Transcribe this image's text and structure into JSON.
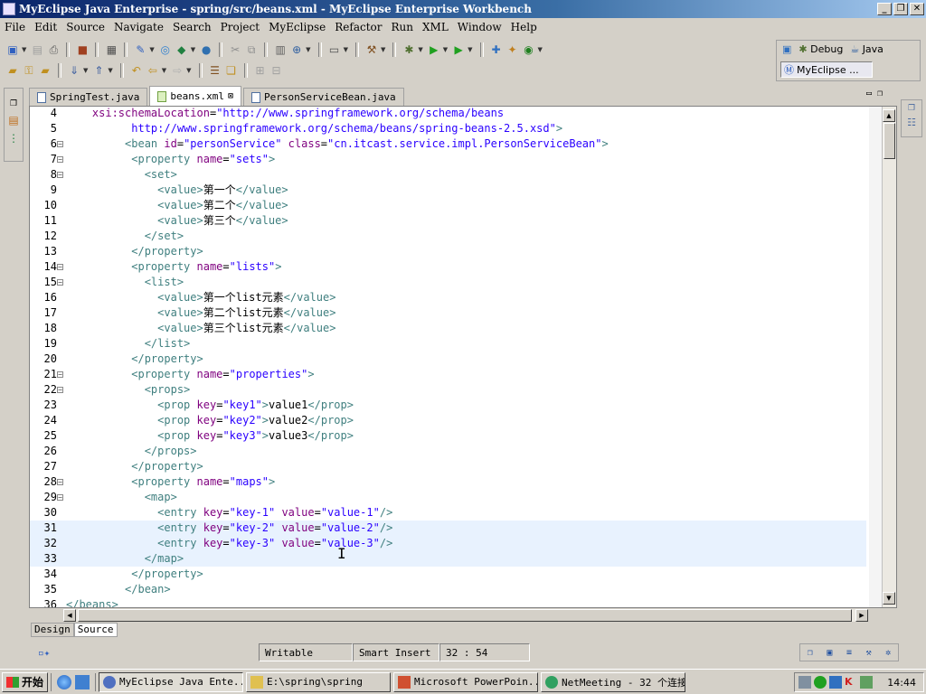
{
  "window": {
    "title": "MyEclipse Java Enterprise - spring/src/beans.xml - MyEclipse Enterprise Workbench",
    "controls": [
      "_",
      "❐",
      "✕"
    ]
  },
  "menu": [
    "File",
    "Edit",
    "Source",
    "Navigate",
    "Search",
    "Project",
    "MyEclipse",
    "Refactor",
    "Run",
    "XML",
    "Window",
    "Help"
  ],
  "perspectives": {
    "debug": "Debug",
    "java": "Java",
    "myeclipse": "MyEclipse ..."
  },
  "tabs": [
    {
      "label": "SpringTest.java",
      "active": false
    },
    {
      "label": "beans.xml",
      "active": true
    },
    {
      "label": "PersonServiceBean.java",
      "active": false
    }
  ],
  "code_lines": [
    {
      "n": "4",
      "indent": "    ",
      "parts": [
        [
          "a",
          "xsi:schemaLocation"
        ],
        [
          "x",
          "="
        ],
        [
          "v",
          "\"http://www.springframework.org/schema/beans"
        ]
      ]
    },
    {
      "n": "5",
      "indent": "          ",
      "parts": [
        [
          "v",
          "http://www.springframework.org/schema/beans/spring-beans-2.5.xsd\""
        ],
        [
          "t",
          ">"
        ]
      ]
    },
    {
      "n": "6",
      "fold": true,
      "indent": "         ",
      "parts": [
        [
          "t",
          "<bean "
        ],
        [
          "a",
          "id"
        ],
        [
          "x",
          "="
        ],
        [
          "v",
          "\"personService\" "
        ],
        [
          "a",
          "class"
        ],
        [
          "x",
          "="
        ],
        [
          "v",
          "\"cn.itcast.service.impl.PersonServiceBean\""
        ],
        [
          "t",
          ">"
        ]
      ]
    },
    {
      "n": "7",
      "fold": true,
      "indent": "          ",
      "parts": [
        [
          "t",
          "<property "
        ],
        [
          "a",
          "name"
        ],
        [
          "x",
          "="
        ],
        [
          "v",
          "\"sets\""
        ],
        [
          "t",
          ">"
        ]
      ]
    },
    {
      "n": "8",
      "fold": true,
      "indent": "            ",
      "parts": [
        [
          "t",
          "<set>"
        ]
      ]
    },
    {
      "n": "9",
      "indent": "              ",
      "parts": [
        [
          "t",
          "<value>"
        ],
        [
          "x",
          "第一个"
        ],
        [
          "t",
          "</value>"
        ]
      ]
    },
    {
      "n": "10",
      "indent": "              ",
      "parts": [
        [
          "t",
          "<value>"
        ],
        [
          "x",
          "第二个"
        ],
        [
          "t",
          "</value>"
        ]
      ]
    },
    {
      "n": "11",
      "indent": "              ",
      "parts": [
        [
          "t",
          "<value>"
        ],
        [
          "x",
          "第三个"
        ],
        [
          "t",
          "</value>"
        ]
      ]
    },
    {
      "n": "12",
      "indent": "            ",
      "parts": [
        [
          "t",
          "</set>"
        ]
      ]
    },
    {
      "n": "13",
      "indent": "          ",
      "parts": [
        [
          "t",
          "</property>"
        ]
      ]
    },
    {
      "n": "14",
      "fold": true,
      "indent": "          ",
      "parts": [
        [
          "t",
          "<property "
        ],
        [
          "a",
          "name"
        ],
        [
          "x",
          "="
        ],
        [
          "v",
          "\"lists\""
        ],
        [
          "t",
          ">"
        ]
      ]
    },
    {
      "n": "15",
      "fold": true,
      "indent": "            ",
      "parts": [
        [
          "t",
          "<list>"
        ]
      ]
    },
    {
      "n": "16",
      "indent": "              ",
      "parts": [
        [
          "t",
          "<value>"
        ],
        [
          "x",
          "第一个list元素"
        ],
        [
          "t",
          "</value>"
        ]
      ]
    },
    {
      "n": "17",
      "indent": "              ",
      "parts": [
        [
          "t",
          "<value>"
        ],
        [
          "x",
          "第二个list元素"
        ],
        [
          "t",
          "</value>"
        ]
      ]
    },
    {
      "n": "18",
      "indent": "              ",
      "parts": [
        [
          "t",
          "<value>"
        ],
        [
          "x",
          "第三个list元素"
        ],
        [
          "t",
          "</value>"
        ]
      ]
    },
    {
      "n": "19",
      "indent": "            ",
      "parts": [
        [
          "t",
          "</list>"
        ]
      ]
    },
    {
      "n": "20",
      "indent": "          ",
      "parts": [
        [
          "t",
          "</property>"
        ]
      ]
    },
    {
      "n": "21",
      "fold": true,
      "indent": "          ",
      "parts": [
        [
          "t",
          "<property "
        ],
        [
          "a",
          "name"
        ],
        [
          "x",
          "="
        ],
        [
          "v",
          "\"properties\""
        ],
        [
          "t",
          ">"
        ]
      ]
    },
    {
      "n": "22",
      "fold": true,
      "indent": "            ",
      "parts": [
        [
          "t",
          "<props>"
        ]
      ]
    },
    {
      "n": "23",
      "indent": "              ",
      "parts": [
        [
          "t",
          "<prop "
        ],
        [
          "a",
          "key"
        ],
        [
          "x",
          "="
        ],
        [
          "v",
          "\"key1\""
        ],
        [
          "t",
          ">"
        ],
        [
          "x",
          "value1"
        ],
        [
          "t",
          "</prop>"
        ]
      ]
    },
    {
      "n": "24",
      "indent": "              ",
      "parts": [
        [
          "t",
          "<prop "
        ],
        [
          "a",
          "key"
        ],
        [
          "x",
          "="
        ],
        [
          "v",
          "\"key2\""
        ],
        [
          "t",
          ">"
        ],
        [
          "x",
          "value2"
        ],
        [
          "t",
          "</prop>"
        ]
      ]
    },
    {
      "n": "25",
      "indent": "              ",
      "parts": [
        [
          "t",
          "<prop "
        ],
        [
          "a",
          "key"
        ],
        [
          "x",
          "="
        ],
        [
          "v",
          "\"key3\""
        ],
        [
          "t",
          ">"
        ],
        [
          "x",
          "value3"
        ],
        [
          "t",
          "</prop>"
        ]
      ]
    },
    {
      "n": "26",
      "indent": "            ",
      "parts": [
        [
          "t",
          "</props>"
        ]
      ]
    },
    {
      "n": "27",
      "indent": "          ",
      "parts": [
        [
          "t",
          "</property>"
        ]
      ]
    },
    {
      "n": "28",
      "fold": true,
      "indent": "          ",
      "parts": [
        [
          "t",
          "<property "
        ],
        [
          "a",
          "name"
        ],
        [
          "x",
          "="
        ],
        [
          "v",
          "\"maps\""
        ],
        [
          "t",
          ">"
        ]
      ]
    },
    {
      "n": "29",
      "fold": true,
      "indent": "            ",
      "parts": [
        [
          "t",
          "<map>"
        ]
      ]
    },
    {
      "n": "30",
      "indent": "              ",
      "parts": [
        [
          "t",
          "<entry "
        ],
        [
          "a",
          "key"
        ],
        [
          "x",
          "="
        ],
        [
          "v",
          "\"key-1\" "
        ],
        [
          "a",
          "value"
        ],
        [
          "x",
          "="
        ],
        [
          "v",
          "\"value-1\""
        ],
        [
          "t",
          "/>"
        ]
      ]
    },
    {
      "n": "31",
      "hl": true,
      "indent": "              ",
      "parts": [
        [
          "t",
          "<entry "
        ],
        [
          "a",
          "key"
        ],
        [
          "x",
          "="
        ],
        [
          "v",
          "\"key-2\" "
        ],
        [
          "a",
          "value"
        ],
        [
          "x",
          "="
        ],
        [
          "v",
          "\"value-2\""
        ],
        [
          "t",
          "/>"
        ]
      ]
    },
    {
      "n": "32",
      "hl": true,
      "indent": "              ",
      "parts": [
        [
          "t",
          "<entry "
        ],
        [
          "a",
          "key"
        ],
        [
          "x",
          "="
        ],
        [
          "v",
          "\"key-3\" "
        ],
        [
          "a",
          "value"
        ],
        [
          "x",
          "="
        ],
        [
          "v",
          "\"value-3\""
        ],
        [
          "t",
          "/>"
        ]
      ]
    },
    {
      "n": "33",
      "hl": true,
      "indent": "            ",
      "parts": [
        [
          "t",
          "</map>"
        ]
      ]
    },
    {
      "n": "34",
      "indent": "          ",
      "parts": [
        [
          "t",
          "</property>"
        ]
      ]
    },
    {
      "n": "35",
      "indent": "         ",
      "parts": [
        [
          "t",
          "</bean>"
        ]
      ]
    },
    {
      "n": "36",
      "indent": "",
      "parts": [
        [
          "t",
          "</beans>"
        ]
      ]
    }
  ],
  "bottom_tabs": {
    "design": "Design",
    "source": "Source"
  },
  "status": {
    "writable": "Writable",
    "insert_mode": "Smart Insert",
    "position": "32 : 54"
  },
  "taskbar": {
    "start": "开始",
    "buttons": [
      {
        "label": "MyEclipse Java Ente...",
        "active": true
      },
      {
        "label": "E:\\spring\\spring",
        "active": false
      },
      {
        "label": "Microsoft PowerPoin...",
        "active": false
      },
      {
        "label": "NetMeeting - 32 个连接",
        "active": false
      }
    ],
    "clock": "14:44"
  }
}
